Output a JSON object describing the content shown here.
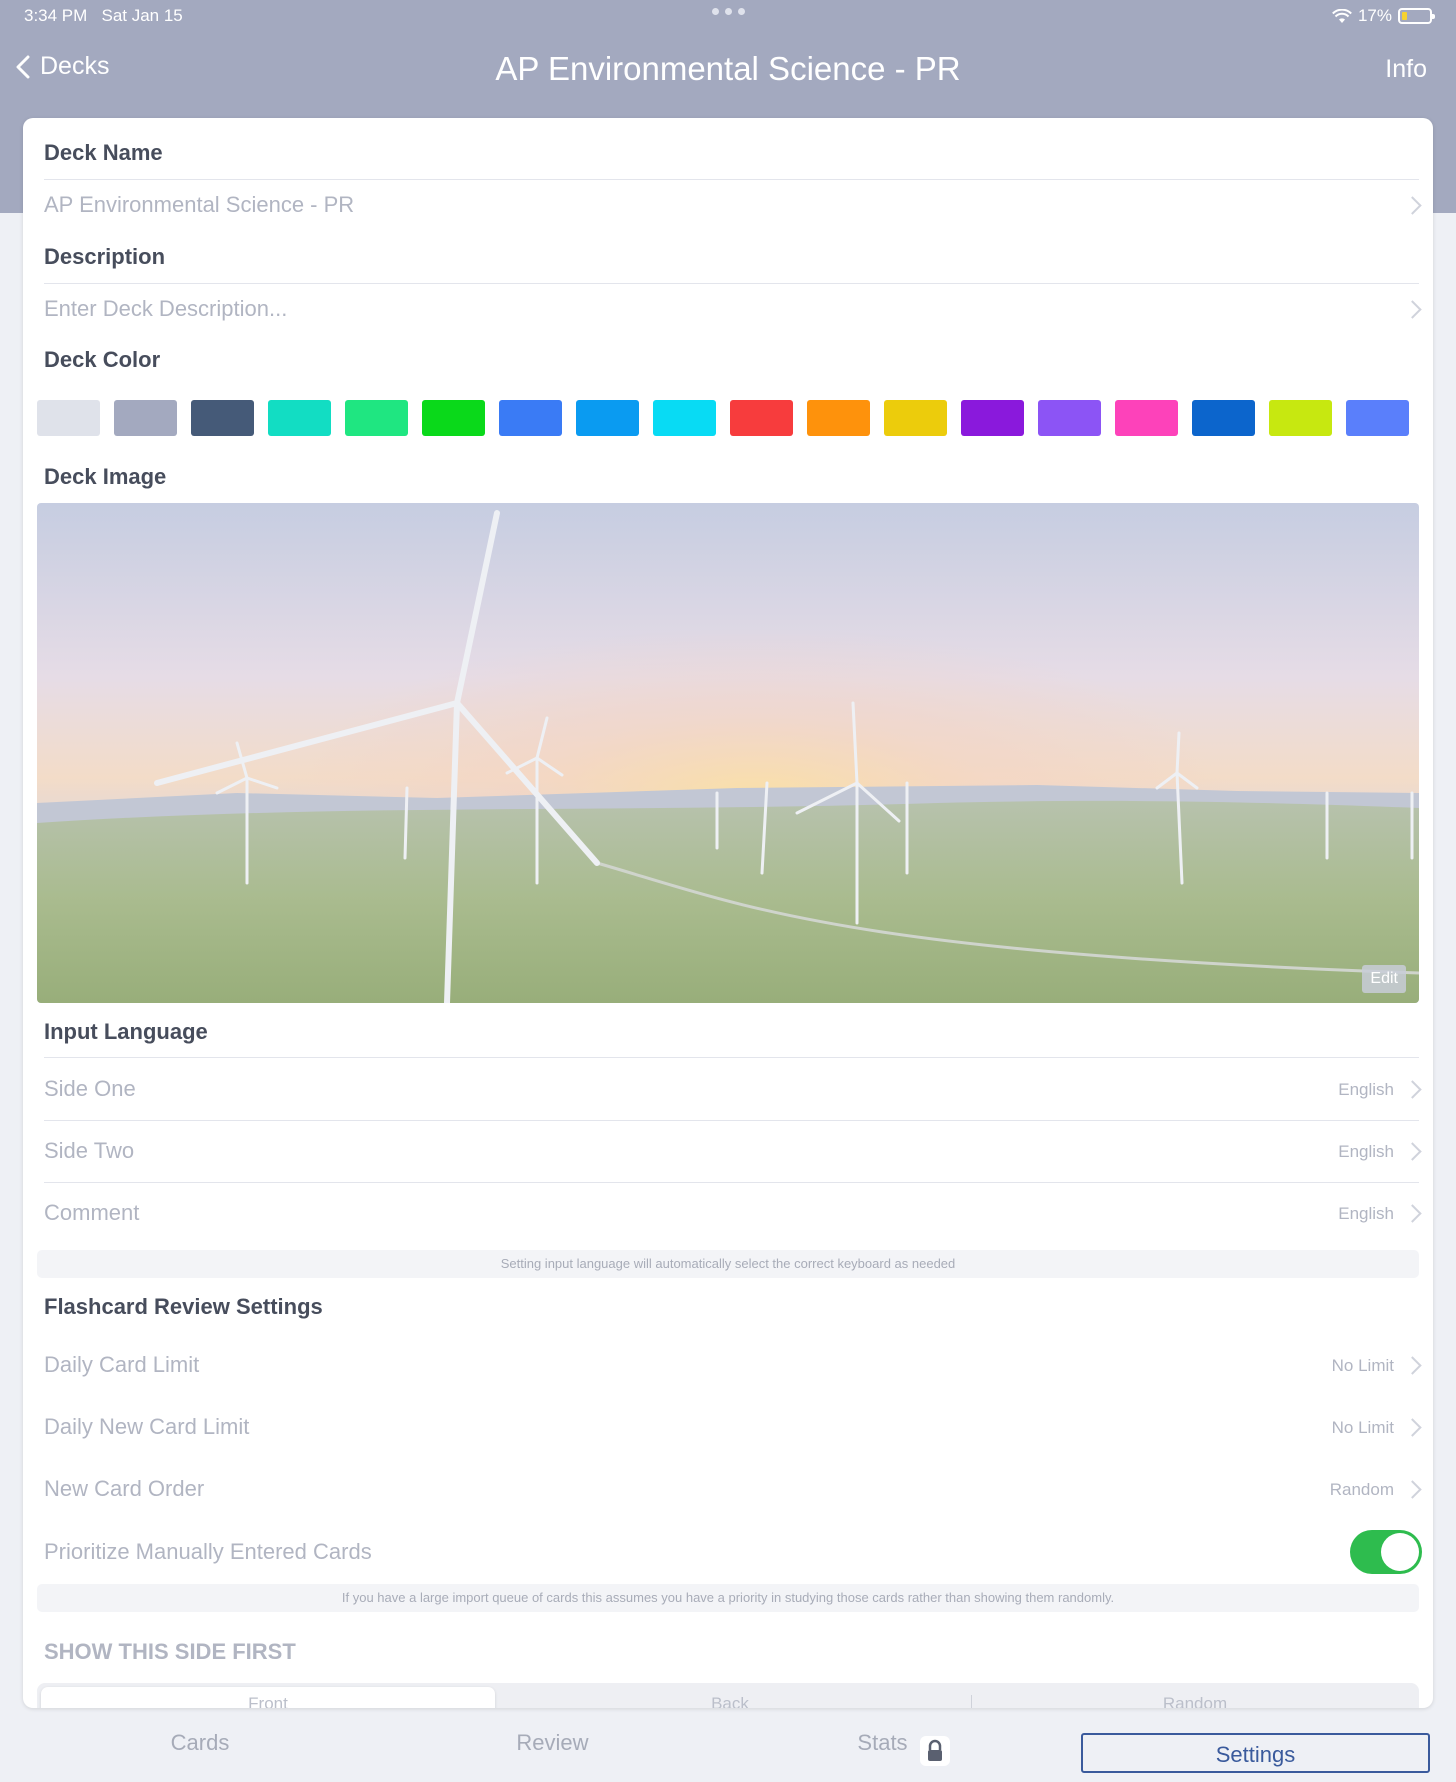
{
  "status_bar": {
    "time": "3:34 PM",
    "date": "Sat Jan 15",
    "battery": "17%"
  },
  "nav": {
    "back_label": "Decks",
    "title": "AP Environmental Science - PR",
    "info_label": "Info"
  },
  "deck_name": {
    "header": "Deck Name",
    "value": "AP Environmental Science - PR"
  },
  "description": {
    "header": "Description",
    "placeholder": "Enter Deck Description..."
  },
  "deck_color": {
    "header": "Deck Color",
    "colors": [
      "#dfe2ea",
      "#a3a9bf",
      "#455a78",
      "#12ddc3",
      "#1fe681",
      "#0ad91a",
      "#3a7bf5",
      "#0a9bf1",
      "#08dbf4",
      "#f73c3d",
      "#fe920c",
      "#eccc0c",
      "#8a19dc",
      "#8c54f5",
      "#fd42ba",
      "#0c65cc",
      "#c7e810",
      "#5a7ffb"
    ]
  },
  "deck_image": {
    "header": "Deck Image",
    "edit_label": "Edit"
  },
  "input_language": {
    "header": "Input Language",
    "rows": [
      {
        "label": "Side One",
        "value": "English"
      },
      {
        "label": "Side Two",
        "value": "English"
      },
      {
        "label": "Comment",
        "value": "English"
      }
    ],
    "note": "Setting input language will automatically select the correct keyboard as needed"
  },
  "review_settings": {
    "header": "Flashcard Review Settings",
    "rows": [
      {
        "label": "Daily Card Limit",
        "value": "No Limit"
      },
      {
        "label": "Daily New Card Limit",
        "value": "No Limit"
      },
      {
        "label": "New Card Order",
        "value": "Random"
      }
    ],
    "prioritize_label": "Prioritize Manually Entered Cards",
    "prioritize_on": true,
    "note": "If you have a large import queue of cards this assumes you have a priority in studying those cards rather than showing them randomly."
  },
  "show_side": {
    "header": "SHOW THIS SIDE FIRST",
    "options": [
      "Front",
      "Back",
      "Random"
    ],
    "selected": "Front"
  },
  "tabs": {
    "cards": "Cards",
    "review": "Review",
    "stats": "Stats",
    "settings": "Settings",
    "selected": "Settings"
  }
}
